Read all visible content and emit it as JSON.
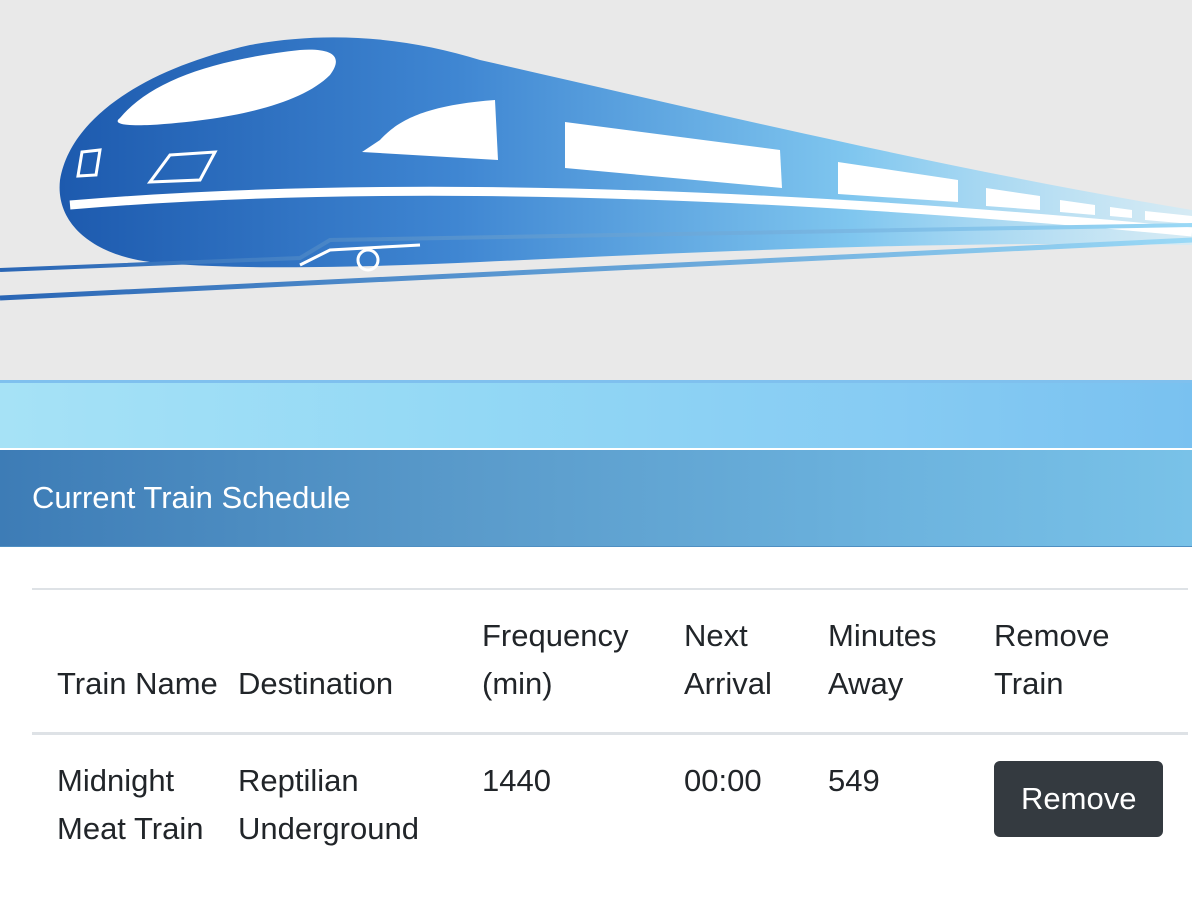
{
  "hero": {
    "image_name": "high-speed-train-logo"
  },
  "panel": {
    "title": "Current Train Schedule"
  },
  "schedule_table": {
    "headers": {
      "train_name": "Train Name",
      "destination": "Destination",
      "frequency": "Frequency (min)",
      "next_arrival": "Next Arrival",
      "minutes_away": "Minutes Away",
      "remove": "Remove Train"
    },
    "rows": [
      {
        "train_name": "Midnight Meat Train",
        "destination": "Reptilian Underground",
        "frequency": "1440",
        "next_arrival": "00:00",
        "minutes_away": "549",
        "remove_label": "Remove"
      }
    ]
  },
  "colors": {
    "hero_bg": "#e9e9e9",
    "train_blue_dark": "#1f5fb0",
    "train_blue_light": "#8fd3f5",
    "heading_blue": "#4a89c0",
    "button_dark": "#343a40"
  }
}
